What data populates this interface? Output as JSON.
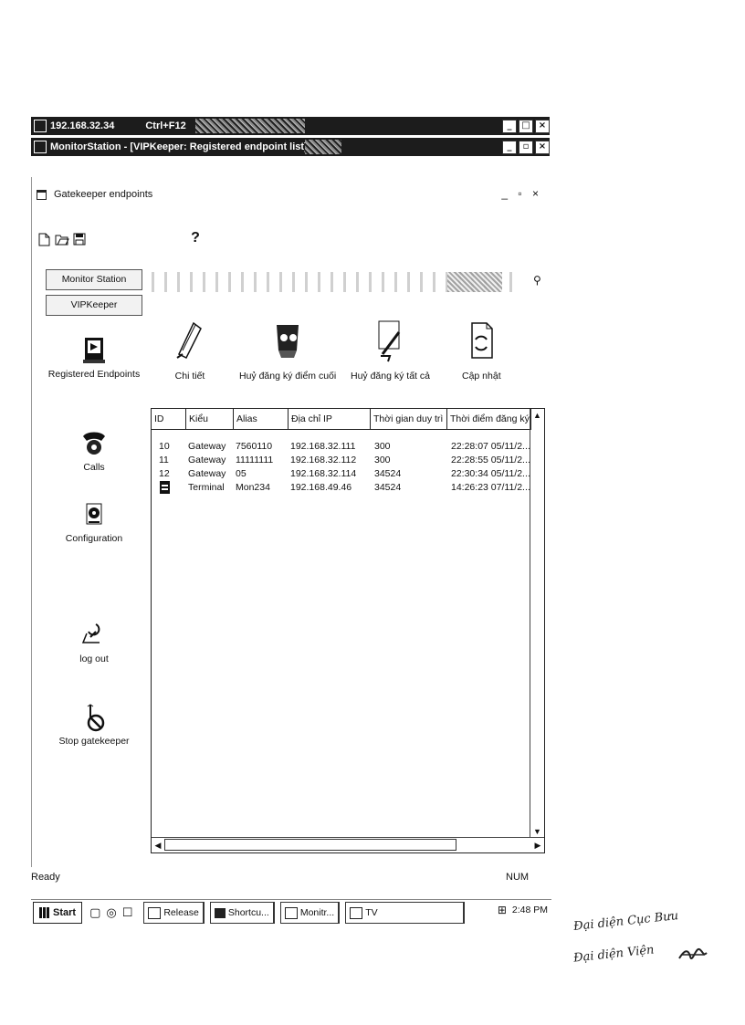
{
  "titlebar1": {
    "title": "192.168.32.34",
    "shortcut": "Ctrl+F12"
  },
  "titlebar2": {
    "title": "MonitorStation - [VIPKeeper: Registered endpoint list]"
  },
  "doc": {
    "title": "Gatekeeper endpoints"
  },
  "toolbar": {
    "icons": [
      "new-icon",
      "open-icon",
      "save-icon"
    ],
    "help": "?"
  },
  "nav": {
    "header1": "Monitor Station",
    "header2": "VIPKeeper",
    "items": [
      {
        "label": "Registered Endpoints",
        "icon": "endpoints-icon"
      },
      {
        "label": "Calls",
        "icon": "calls-icon"
      },
      {
        "label": "Configuration",
        "icon": "configuration-icon"
      },
      {
        "label": "log out",
        "icon": "logout-icon"
      },
      {
        "label": "Stop gatekeeper",
        "icon": "stop-gatekeeper-icon"
      }
    ]
  },
  "actions": {
    "details": "Chi tiết",
    "unregister_endpoint": "Huỷ đăng ký điểm cuối",
    "unregister_all": "Huỷ đăng ký tất cả",
    "refresh": "Cập nhật"
  },
  "table": {
    "columns": [
      "ID",
      "Kiểu",
      "Alias",
      "Địa chỉ IP",
      "Thời gian duy trì",
      "Thời điểm đăng ký"
    ],
    "rows": [
      [
        "10",
        "Gateway",
        "7560110",
        "192.168.32.111",
        "300",
        "22:28:07 05/11/2..."
      ],
      [
        "11",
        "Gateway",
        "11111111",
        "192.168.32.112",
        "300",
        "22:28:55 05/11/2..."
      ],
      [
        "12",
        "Gateway",
        "05",
        "192.168.32.114",
        "34524",
        "22:30:34 05/11/2..."
      ],
      [
        "",
        "Terminal",
        "Mon234",
        "192.168.49.46",
        "34524",
        "14:26:23 07/11/2..."
      ]
    ]
  },
  "status": {
    "left": "Ready",
    "right": "NUM"
  },
  "taskbar": {
    "start": "Start",
    "buttons": [
      "Release",
      "Shortcu...",
      "Monitr...",
      "TV"
    ],
    "clock": "2:48 PM"
  },
  "signature": {
    "line1": "Đại diện Cục Bưu",
    "line2": "Đại diện Viện"
  }
}
